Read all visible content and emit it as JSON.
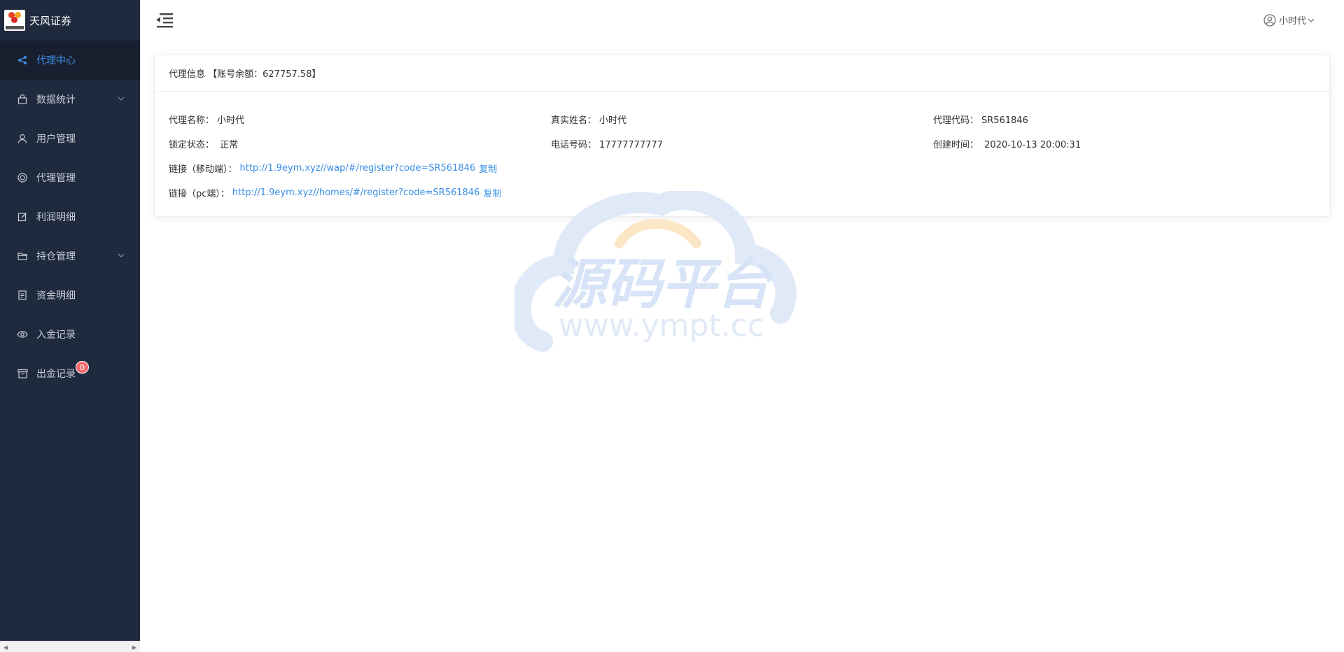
{
  "brand": {
    "name": "天风证券"
  },
  "sidebar": {
    "items": [
      {
        "label": "代理中心",
        "icon": "share-icon",
        "active": true
      },
      {
        "label": "数据统计",
        "icon": "bag-icon",
        "expandable": true
      },
      {
        "label": "用户管理",
        "icon": "user-icon"
      },
      {
        "label": "代理管理",
        "icon": "help-ring-icon"
      },
      {
        "label": "利润明细",
        "icon": "edit-icon"
      },
      {
        "label": "持仓管理",
        "icon": "folder-icon",
        "expandable": true
      },
      {
        "label": "资金明细",
        "icon": "document-icon"
      },
      {
        "label": "入金记录",
        "icon": "eye-icon"
      },
      {
        "label": "出金记录",
        "icon": "box-icon",
        "badge": "0"
      }
    ]
  },
  "header": {
    "user_name": "小时代"
  },
  "card": {
    "title": "代理信息 【账号余额：627757.58】",
    "fields": {
      "agent_name_label": "代理名称：",
      "agent_name": "小时代",
      "real_name_label": "真实姓名：",
      "real_name": "小时代",
      "agent_code_label": "代理代码：",
      "agent_code": "SR561846",
      "lock_status_label": "锁定状态：",
      "lock_status": "正常",
      "phone_label": "电话号码：",
      "phone": "17777777777",
      "created_label": "创建时间：",
      "created": "2020-10-13 20:00:31"
    },
    "links": {
      "mobile_label": "链接（移动端）：",
      "mobile_url": "http://1.9eym.xyz//wap/#/register?code=SR561846",
      "pc_label": "链接（pc端）：",
      "pc_url": "http://1.9eym.xyz//homes/#/register?code=SR561846",
      "copy_label": "复制"
    }
  },
  "watermark": {
    "title": "源码平台",
    "url": "www.ympt.cc"
  },
  "colors": {
    "sidebar_bg": "#1f2a3e",
    "active_text": "#3d8eea",
    "link": "#3a8ee6",
    "badge": "#f56c6c"
  }
}
